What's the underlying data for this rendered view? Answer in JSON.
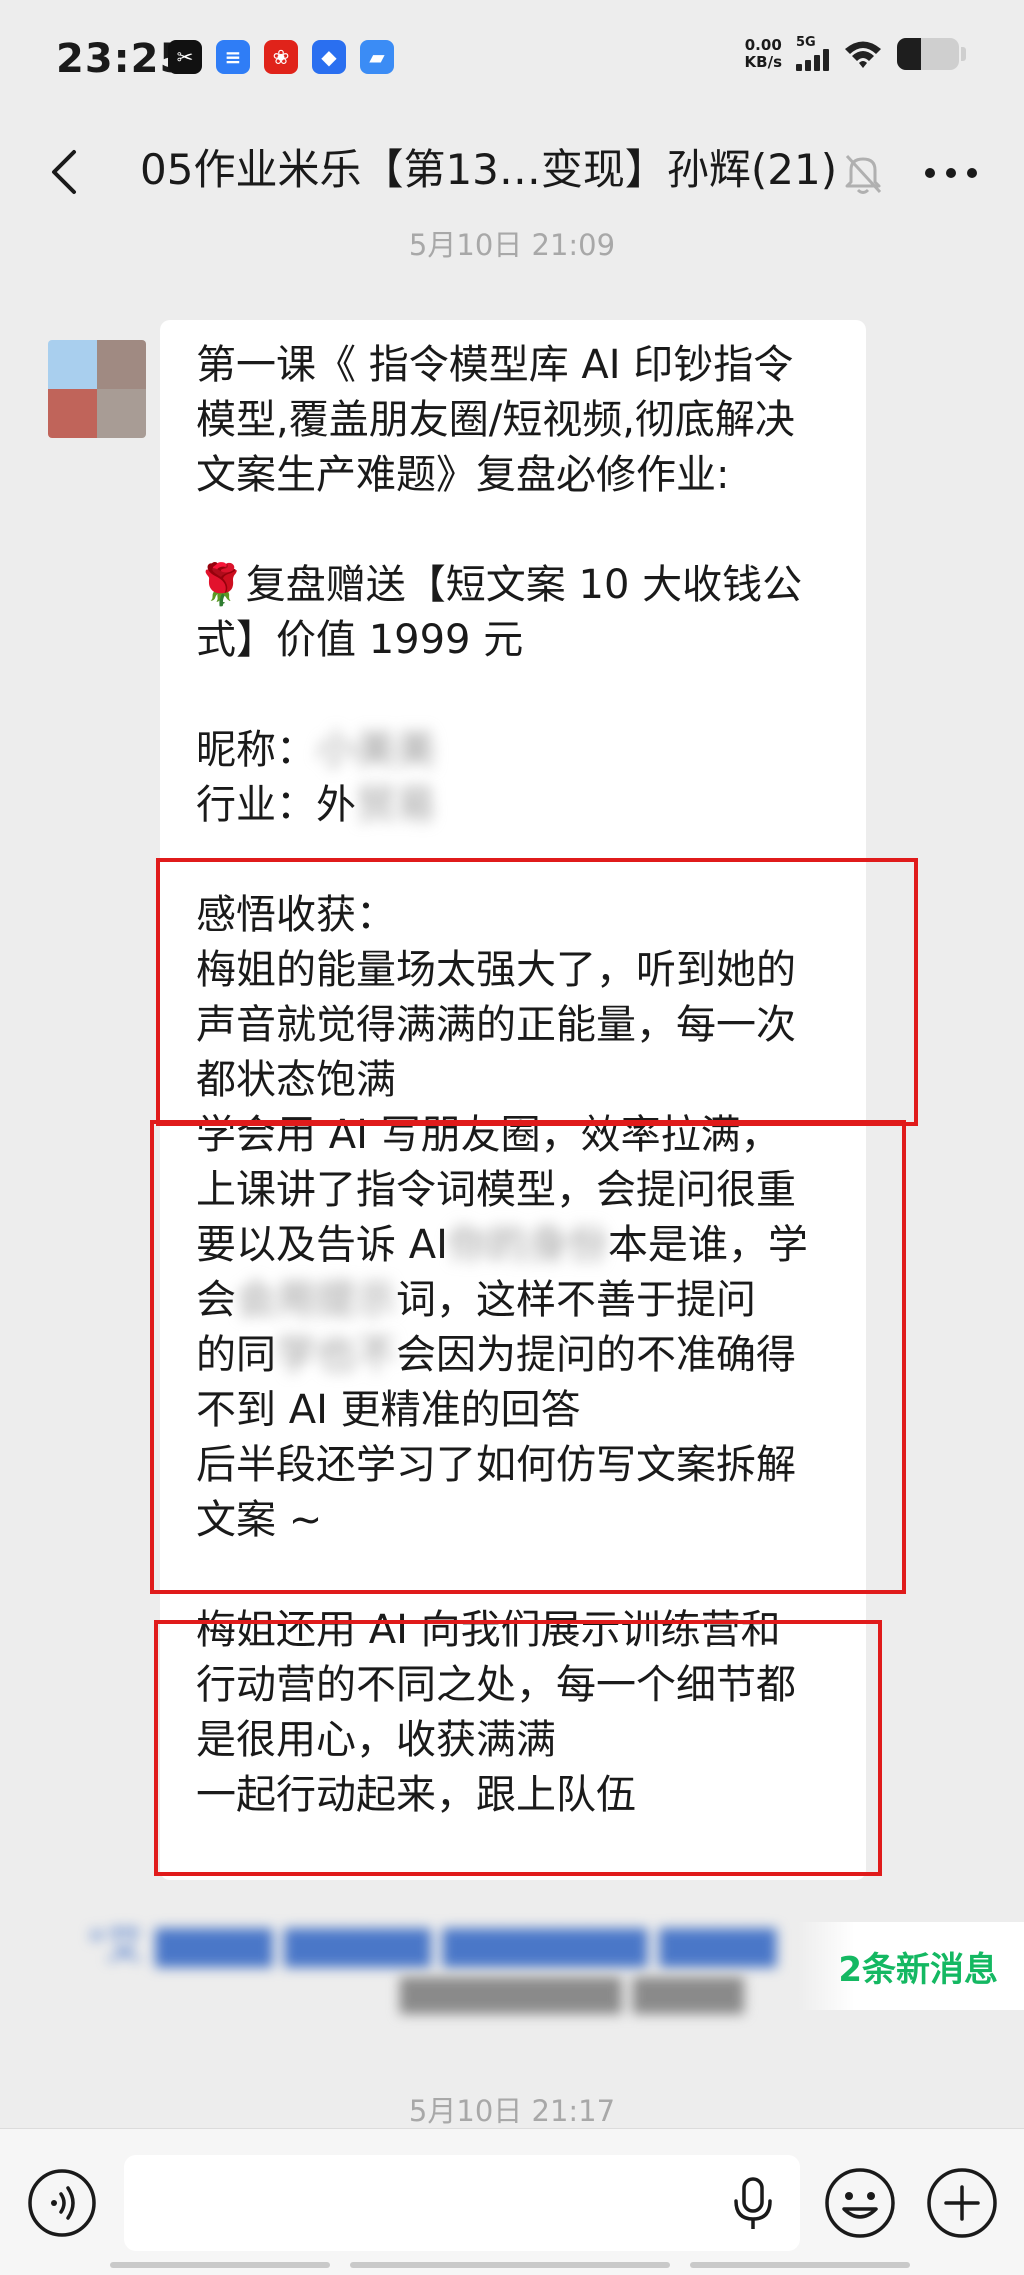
{
  "status_bar": {
    "time": "23:25",
    "net_speed_value": "0.00",
    "net_speed_unit": "KB/s",
    "network_type": "5G",
    "battery_level": 0.38,
    "app_icons": [
      "capcut-icon",
      "messages-icon",
      "pinduoduo-icon",
      "feishu-icon",
      "files-icon"
    ]
  },
  "header": {
    "title": "05作业米乐【第13…变现】孙辉(21)"
  },
  "timestamps": {
    "top": "5月10日 21:09",
    "bottom": "5月10日 21:17"
  },
  "message": {
    "lines": [
      "第一课《 指令模型库 AI 印钞指令",
      "模型,覆盖朋友圈/短视频,彻底解决",
      "文案生产难题》复盘必修作业:",
      "",
      "🌹复盘赠送【短文案 10 大收钱公",
      "式】价值 1999 元",
      "",
      "昵称：",
      "行业：外",
      "",
      "感悟收获：",
      "梅姐的能量场太强大了，听到她的",
      "声音就觉得满满的正能量，每一次",
      "都状态饱满",
      "学会用 AI 写朋友圈，效率拉满，",
      "上课讲了指令词模型，会提问很重",
      "要以及告诉 AI",
      "本是谁，学",
      "会",
      "词，这样不善于提问",
      "的同",
      "会因为提问的不准确得",
      "不到 AI 更精准的回答",
      "后半段还学习了如何仿写文案拆解",
      "文案 ~",
      "",
      "梅姐还用 AI 向我们展示训练营和",
      "行动营的不同之处，每一个细节都",
      "是很用心，收获满满",
      "一起行动起来，跟上队伍"
    ],
    "blurred": {
      "nickname": "小美美",
      "industry": "贸易",
      "ai_redacted": "你的身份",
      "learn_redacted": "会用提示",
      "classmate_redacted": "学也不"
    }
  },
  "new_messages": {
    "preview": "艾",
    "badge": "2条新消息"
  },
  "input_bar": {
    "placeholder": ""
  },
  "colors": {
    "highlight_border": "#e01b1b",
    "new_message_text": "#14b862",
    "background": "#ededed"
  }
}
